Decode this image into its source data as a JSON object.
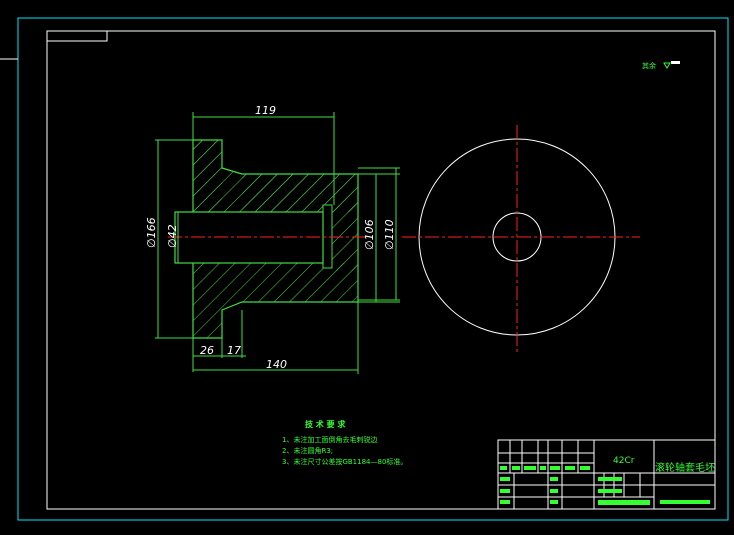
{
  "drawing": {
    "dimensions": {
      "top_length": "119",
      "dia_outer": "∅166",
      "dia_bore": "∅42",
      "dia_106": "∅106",
      "dia_110": "∅110",
      "bottom_26": "26",
      "bottom_17": "17",
      "total_length": "140"
    },
    "surface_note": "其余"
  },
  "technical_requirements": {
    "title": "技 术 要 求",
    "items": [
      "1、未注加工面倒角去毛刺锐边",
      "2、未注圆角R3;",
      "3、未注尺寸公差按GB1184—80标准。"
    ]
  },
  "title_block": {
    "material": "42Cr",
    "part_name": "滚轮轴套毛坯"
  },
  "colors": {
    "background": "#000000",
    "frame": "#ffffff",
    "title_block_frame": "#00e5ff",
    "part_lines": "#3fe03f",
    "dim_lines": "#3fe03f",
    "center_lines": "#ff2020",
    "circle_view": "#ffffff"
  }
}
